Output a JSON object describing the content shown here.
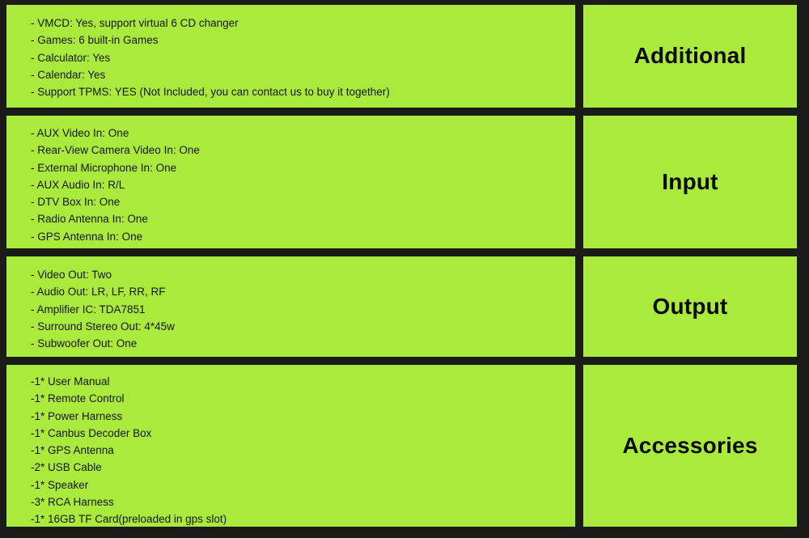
{
  "theme": {
    "panel_green": "#a9ea3c",
    "background_dark": "#1b1c18",
    "item_text_color": "#161622",
    "label_text_color": "#0a0a0a"
  },
  "sections": [
    {
      "label": "Additional",
      "items": [
        "- VMCD: Yes, support virtual 6 CD changer",
        "- Games: 6 built-in Games",
        "- Calculator: Yes",
        "- Calendar: Yes",
        "- Support TPMS: YES (Not Included, you can contact us to buy it together)"
      ]
    },
    {
      "label": "Input",
      "items": [
        "- AUX Video In: One",
        "- Rear-View Camera Video In: One",
        "- External Microphone In: One",
        "- AUX Audio In: R/L",
        "- DTV Box In: One",
        "- Radio Antenna In: One",
        "- GPS Antenna In: One"
      ]
    },
    {
      "label": "Output",
      "items": [
        "- Video Out: Two",
        "- Audio Out: LR, LF, RR, RF",
        "- Amplifier IC: TDA7851",
        "- Surround Stereo Out: 4*45w",
        "- Subwoofer Out: One"
      ]
    },
    {
      "label": "Accessories",
      "items": [
        "-1* User Manual",
        "-1* Remote Control",
        "-1* Power Harness",
        "-1* Canbus Decoder Box",
        "-1* GPS Antenna",
        "-2* USB Cable",
        "-1* Speaker",
        "-3* RCA Harness",
        "-1* 16GB TF Card(preloaded in gps slot)"
      ]
    }
  ]
}
